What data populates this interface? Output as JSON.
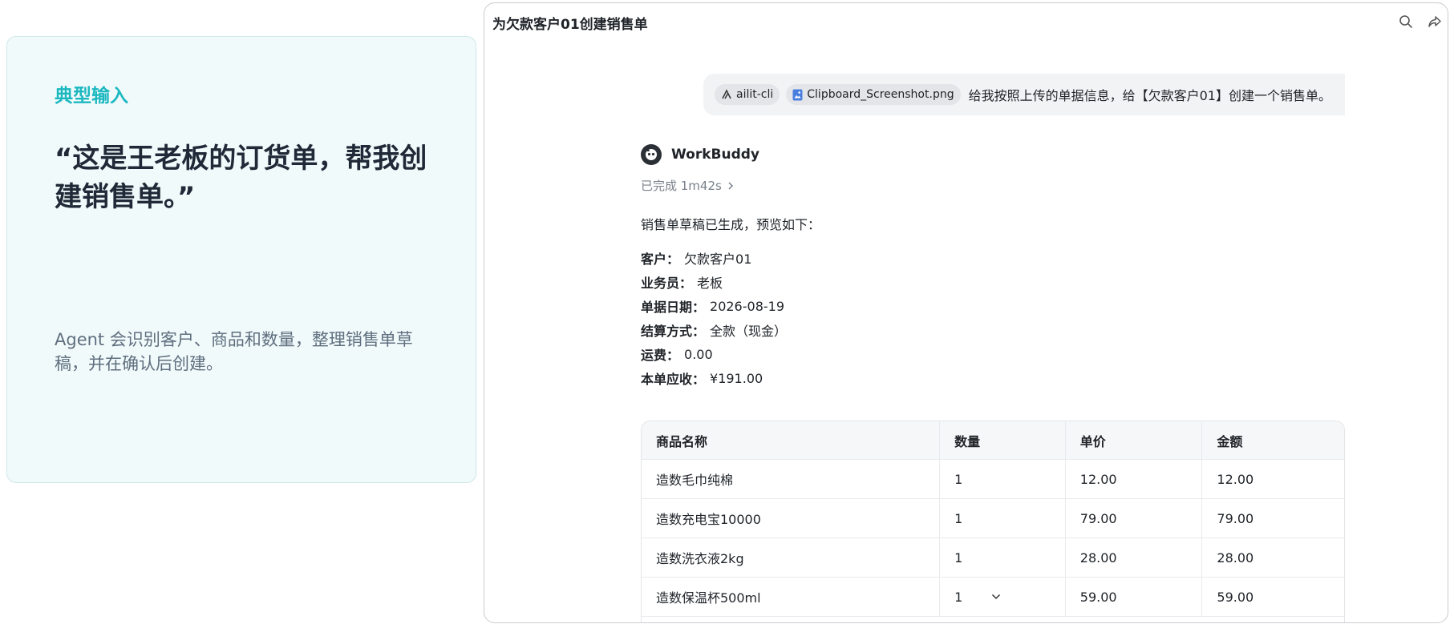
{
  "info": {
    "label": "典型输入",
    "quote": "“这是王老板的订货单，帮我创建销售单。”",
    "description": "Agent 会识别客户、商品和数量，整理销售单草稿，并在确认后创建。"
  },
  "window": {
    "title": "为欠款客户01创建销售单"
  },
  "user_message": {
    "chip_cli": "ailit-cli",
    "chip_file": "Clipboard_Screenshot.png",
    "text": "给我按照上传的单据信息，给【欠款客户01】创建一个销售单。"
  },
  "agent": {
    "name": "WorkBuddy",
    "status": "已完成 1m42s",
    "intro": "销售单草稿已生成，预览如下："
  },
  "fields": [
    {
      "key": "客户：",
      "value": "欠款客户01"
    },
    {
      "key": "业务员：",
      "value": "老板"
    },
    {
      "key": "单据日期：",
      "value": "2026-08-19"
    },
    {
      "key": "结算方式：",
      "value": "全款（现金）"
    },
    {
      "key": "运费：",
      "value": "0.00"
    },
    {
      "key": "本单应收：",
      "value": "¥191.00"
    }
  ],
  "table": {
    "headers": [
      "商品名称",
      "数量",
      "单价",
      "金额"
    ],
    "rows": [
      [
        "造数毛巾纯棉",
        "1",
        "12.00",
        "12.00"
      ],
      [
        "造数充电宝10000",
        "1",
        "79.00",
        "79.00"
      ],
      [
        "造数洗衣液2kg",
        "1",
        "28.00",
        "28.00"
      ],
      [
        "造数保温杯500ml",
        "1",
        "59.00",
        "59.00"
      ]
    ]
  },
  "colors": {
    "accent": "#1cb8c0",
    "card_bg": "#f1fafb"
  }
}
